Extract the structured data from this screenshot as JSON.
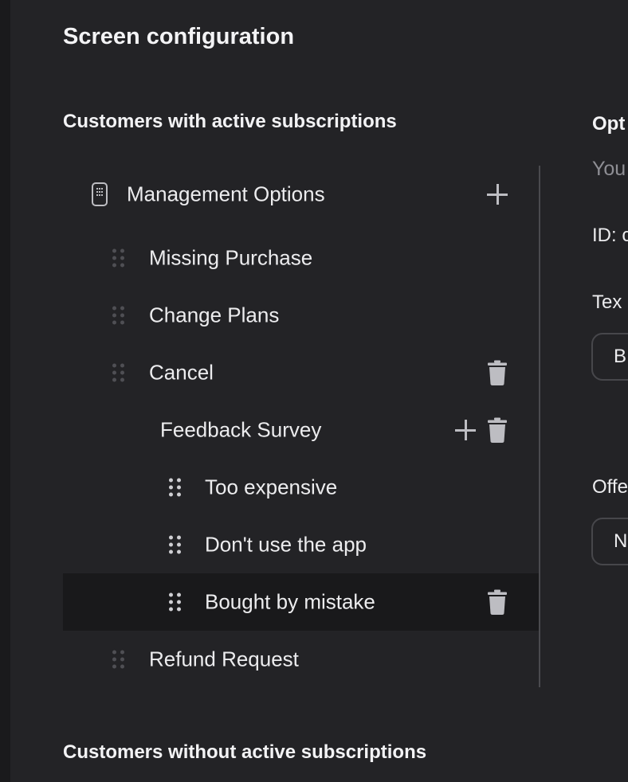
{
  "page": {
    "title": "Screen configuration"
  },
  "sections": {
    "active": "Customers with active subscriptions",
    "inactive": "Customers without active subscriptions"
  },
  "tree": {
    "root": "Management Options",
    "items": [
      {
        "label": "Missing Purchase"
      },
      {
        "label": "Change Plans"
      },
      {
        "label": "Cancel"
      },
      {
        "label": "Feedback Survey"
      },
      {
        "label": "Too expensive"
      },
      {
        "label": "Don't use the app"
      },
      {
        "label": "Bought by mistake",
        "selected": true
      },
      {
        "label": "Refund Request"
      }
    ]
  },
  "right_panel": {
    "heading": "Opt",
    "subtitle": "You",
    "id_label": "ID: c",
    "text_label": "Tex",
    "text_value": "B",
    "offer_label": "Offe",
    "offer_value": "N"
  },
  "colors": {
    "background": "#232326",
    "selected_row": "#19191b",
    "text": "#ececee",
    "muted": "#8e8e94"
  },
  "icons": [
    "phone-icon",
    "plus-icon",
    "drag-handle-icon",
    "trash-icon"
  ]
}
